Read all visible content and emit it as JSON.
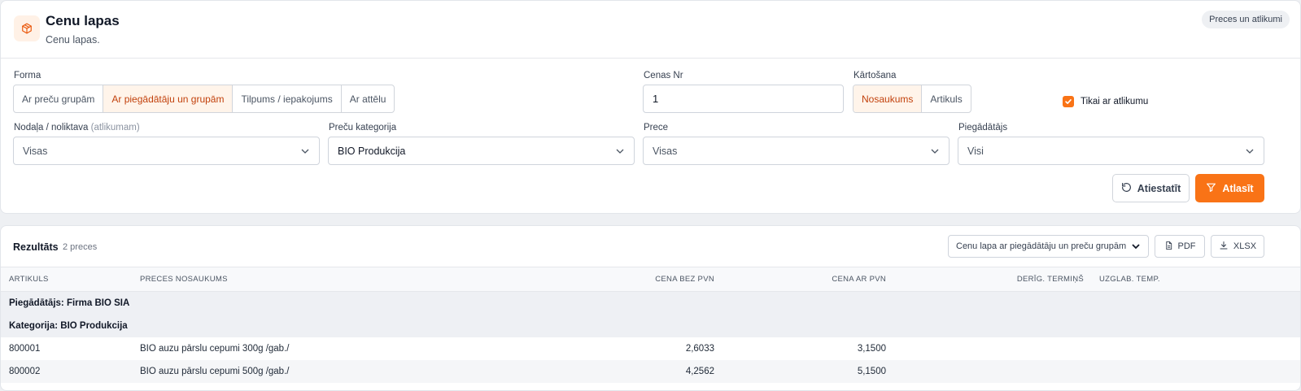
{
  "header": {
    "title": "Cenu lapas",
    "subtitle": "Cenu lapas.",
    "badge": "Preces un atlikumi",
    "icon": "box-icon"
  },
  "filters": {
    "forma": {
      "label": "Forma",
      "options": [
        "Ar preču grupām",
        "Ar piegādātāju un grupām",
        "Tilpums / iepakojums",
        "Ar attēlu"
      ],
      "selected": "Ar piegādātāju un grupām"
    },
    "cenas_nr": {
      "label": "Cenas Nr",
      "value": "1"
    },
    "kartosana": {
      "label": "Kārtošana",
      "options": [
        "Nosaukums",
        "Artikuls"
      ],
      "selected": "Nosaukums"
    },
    "tikai_ar_atlikumu": {
      "label": "Tikai ar atlikumu",
      "checked": true
    },
    "nodala": {
      "label": "Nodaļa / noliktava",
      "hint": "(atlikumam)",
      "value": "Visas"
    },
    "kategorija": {
      "label": "Preču kategorija",
      "value": "BIO Produkcija"
    },
    "prece": {
      "label": "Prece",
      "value": "Visas"
    },
    "piegadatajs": {
      "label": "Piegādātājs",
      "value": "Visi"
    },
    "reset_label": "Atiestatīt",
    "submit_label": "Atlasīt"
  },
  "results": {
    "title": "Rezultāts",
    "count": "2 preces",
    "report_select": "Cenu lapa ar piegādātāju un preču grupām",
    "pdf_label": "PDF",
    "xlsx_label": "XLSX",
    "columns": {
      "artikuls": "ARTIKULS",
      "nosaukums": "PRECES NOSAUKUMS",
      "cena_bez": "CENA BEZ PVN",
      "cena_ar": "CENA AR PVN",
      "termins": "DERĪG. TERMIŅŠ",
      "temp": "UZGLAB. TEMP."
    },
    "supplier_group": "Piegādātājs: Firma BIO SIA",
    "category_group": "Kategorija: BIO Produkcija",
    "rows": [
      {
        "artikuls": "800001",
        "nosaukums": "BIO auzu pārslu cepumi 300g /gab./",
        "cena_bez": "2,6033",
        "cena_ar": "3,1500",
        "termins": "",
        "temp": ""
      },
      {
        "artikuls": "800002",
        "nosaukums": "BIO auzu pārslu cepumi 500g /gab./",
        "cena_bez": "4,2562",
        "cena_ar": "5,1500",
        "termins": "",
        "temp": ""
      }
    ]
  },
  "colors": {
    "accent": "#f97316",
    "accent_soft": "#fff4ea",
    "accent_text": "#c2410c"
  }
}
